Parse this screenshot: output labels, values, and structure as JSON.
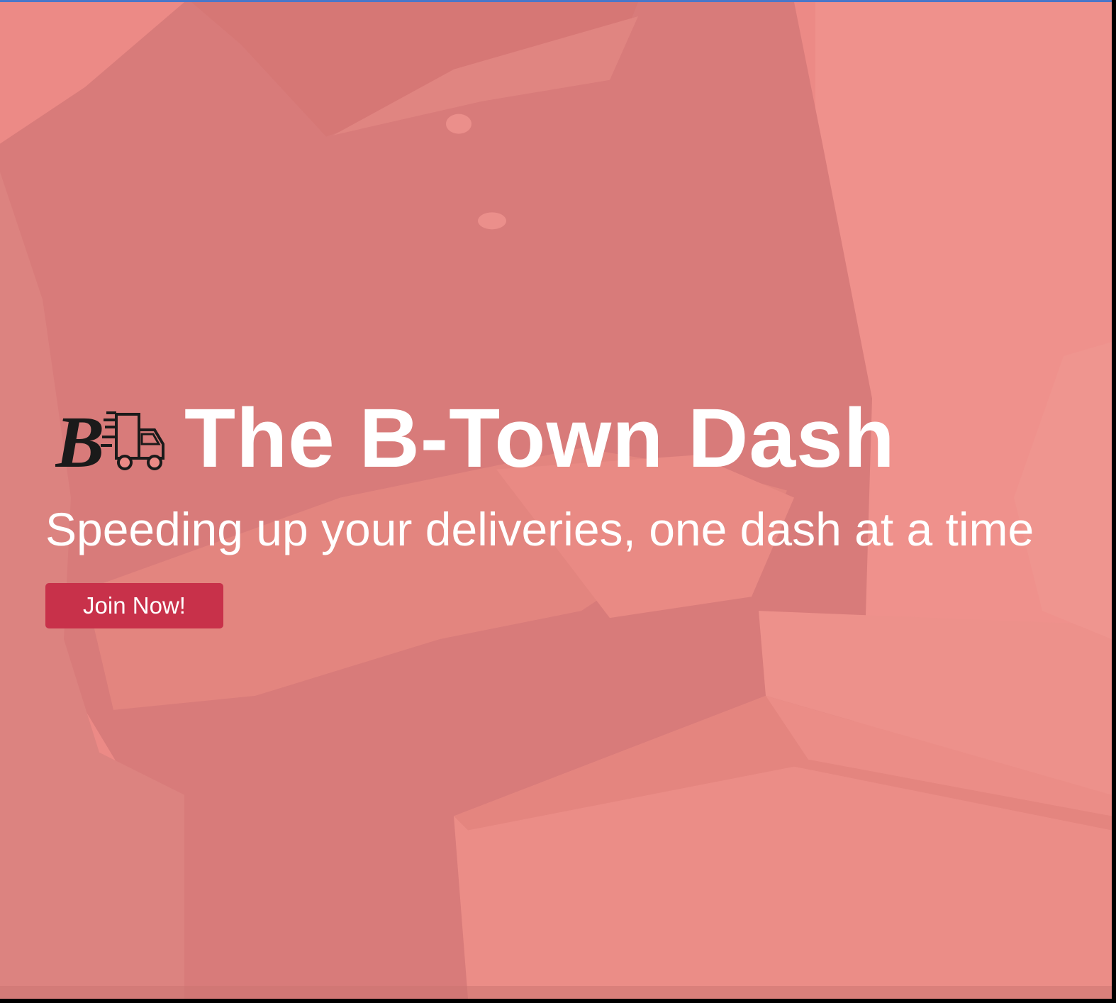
{
  "hero": {
    "title": "The B-Town Dash",
    "tagline": "Speeding up your deliveries, one dash at a time",
    "cta_label": "Join Now!"
  },
  "colors": {
    "overlay": "#ec8a86",
    "cta_background": "#c8314a",
    "text": "#ffffff",
    "logo": "#1a1a1a"
  },
  "logo": {
    "icon": "b-delivery-truck-logo",
    "letter": "B"
  }
}
